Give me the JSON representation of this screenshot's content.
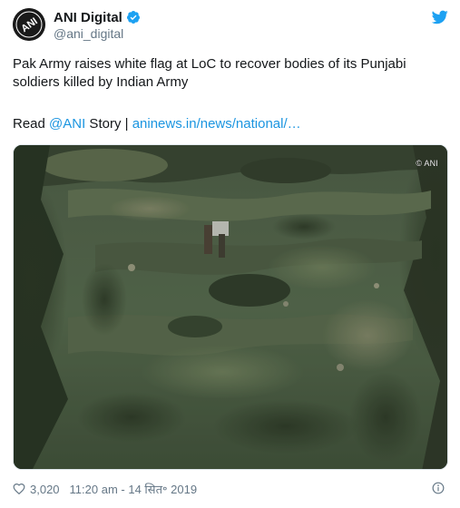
{
  "author": {
    "display_name": "ANI Digital",
    "handle": "@ani_digital",
    "avatar_text": "ANI"
  },
  "tweet": {
    "line1": "Pak Army raises white flag at LoC to recover bodies of its Punjabi",
    "line2": "soldiers killed by Indian Army",
    "read_prefix": "Read ",
    "mention": "@ANI",
    "story_text": " Story | ",
    "link_text": "aninews.in/news/national/…"
  },
  "media": {
    "watermark": "© ANI"
  },
  "footer": {
    "likes": "3,020",
    "timestamp": "11:20 am - 14 सित॰ 2019"
  },
  "colors": {
    "link": "#1b95e0",
    "verified": "#1da1f2",
    "twitter": "#1da1f2",
    "secondary_text": "#657786"
  },
  "icons": [
    "verified-badge-icon",
    "twitter-bird-icon",
    "heart-icon",
    "info-icon"
  ]
}
